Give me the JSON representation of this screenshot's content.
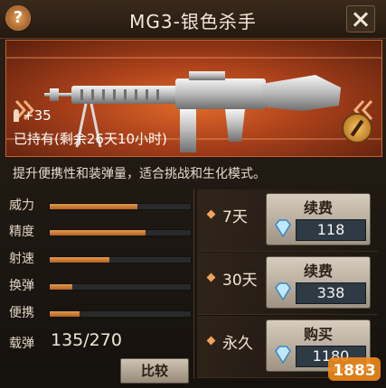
{
  "header": {
    "title": "MG3-银色杀手",
    "help_icon": "?"
  },
  "weapon": {
    "ammo_bonus": "+35",
    "ownership": "已持有(剩余26天10小时)"
  },
  "description": "提升便携性和装弹量，适合挑战和生化模式。",
  "stats": [
    {
      "label": "威力",
      "level": 0.62
    },
    {
      "label": "精度",
      "level": 0.68
    },
    {
      "label": "射速",
      "level": 0.42
    },
    {
      "label": "换弹",
      "level": 0.16
    },
    {
      "label": "便携",
      "level": 0.21
    }
  ],
  "ammo_capacity": {
    "label": "载弹",
    "value": "135/270"
  },
  "compare_button": "比较",
  "options": [
    {
      "duration": "7天",
      "action": "续费",
      "price": "118"
    },
    {
      "duration": "30天",
      "action": "续费",
      "price": "338"
    },
    {
      "duration": "永久",
      "action": "购买",
      "price": "1180"
    }
  ],
  "watermark": "1883",
  "colors": {
    "accent": "#e36b2a",
    "bar": "#d98c45"
  }
}
